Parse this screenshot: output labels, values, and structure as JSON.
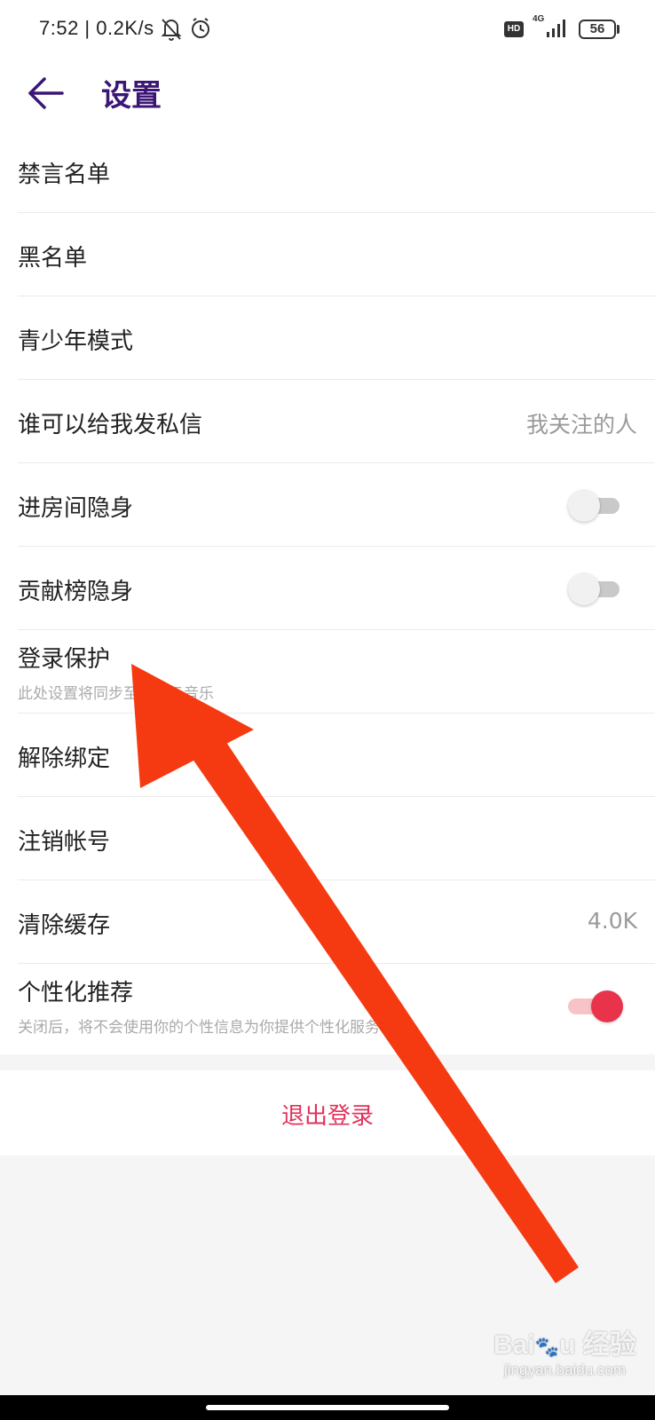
{
  "status_bar": {
    "time": "7:52 | 0.2K/s",
    "network": "4G",
    "hd": "HD",
    "battery": "56"
  },
  "header": {
    "title": "设置"
  },
  "settings": [
    {
      "label": "禁言名单"
    },
    {
      "label": "黑名单"
    },
    {
      "label": "青少年模式"
    },
    {
      "label": "谁可以给我发私信",
      "value": "我关注的人"
    },
    {
      "label": "进房间隐身",
      "toggle": false
    },
    {
      "label": "贡献榜隐身",
      "toggle": false
    },
    {
      "label": "登录保护",
      "sub": "此处设置将同步至网易云音乐"
    },
    {
      "label": "解除绑定"
    },
    {
      "label": "注销帐号"
    },
    {
      "label": "清除缓存",
      "value": "4.0K"
    },
    {
      "label": "个性化推荐",
      "sub": "关闭后，将不会使用你的个性信息为你提供个性化服务",
      "toggle": true
    }
  ],
  "logout": {
    "label": "退出登录"
  },
  "watermark": {
    "logo": "Bai du 经验",
    "url": "jingyan.baidu.com"
  },
  "colors": {
    "title": "#3b1675",
    "accent": "#e8334a",
    "logout": "#e0325a",
    "arrow": "#f53a12"
  }
}
